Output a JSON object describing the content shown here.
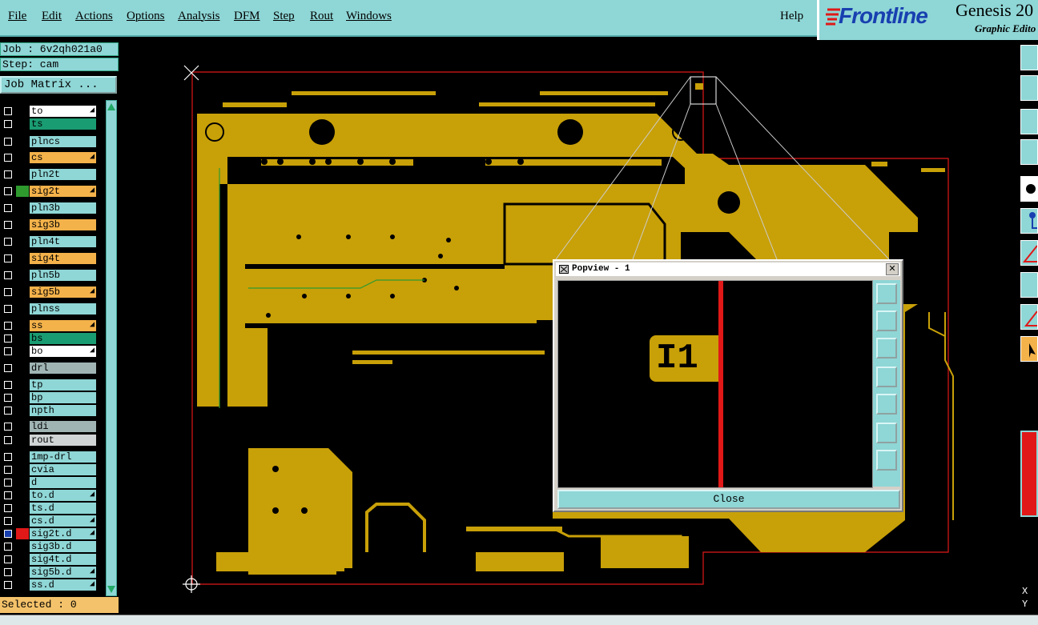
{
  "menu": [
    "File",
    "Edit",
    "Actions",
    "Options",
    "Analysis",
    "DFM",
    "Step",
    "Rout",
    "Windows"
  ],
  "help": "Help",
  "brand": {
    "logo": "Frontline",
    "product": "Genesis 20",
    "subtitle": "Graphic Edito"
  },
  "job": {
    "job_label": "Job : 6v2qh021a0",
    "step_label": "Step: cam",
    "matrix_button": "Job Matrix ..."
  },
  "layers": [
    {
      "name": "to",
      "color": "#ffffff",
      "arrow": true
    },
    {
      "name": "ts",
      "color": "#1a9c72",
      "arrow": false
    },
    {
      "name": "plncs",
      "color": "#8fd6d6",
      "arrow": false
    },
    {
      "name": "cs",
      "color": "#f4b24a",
      "arrow": true
    },
    {
      "name": "pln2t",
      "color": "#8fd6d6",
      "arrow": false
    },
    {
      "name": "sig2t",
      "color": "#f4b24a",
      "arrow": true,
      "swatch": "#2e9a2e"
    },
    {
      "name": "pln3b",
      "color": "#8fd6d6",
      "arrow": false
    },
    {
      "name": "sig3b",
      "color": "#f4b24a",
      "arrow": false
    },
    {
      "name": "pln4t",
      "color": "#8fd6d6",
      "arrow": false
    },
    {
      "name": "sig4t",
      "color": "#f4b24a",
      "arrow": false
    },
    {
      "name": "pln5b",
      "color": "#8fd6d6",
      "arrow": false
    },
    {
      "name": "sig5b",
      "color": "#f4b24a",
      "arrow": true
    },
    {
      "name": "plnss",
      "color": "#8fd6d6",
      "arrow": false
    },
    {
      "name": "ss",
      "color": "#f4b24a",
      "arrow": true
    },
    {
      "name": "bs",
      "color": "#1a9c72",
      "arrow": false
    },
    {
      "name": "bo",
      "color": "#ffffff",
      "arrow": true
    },
    {
      "name": "drl",
      "color": "#a0b4b4",
      "arrow": false
    },
    {
      "name": "tp",
      "color": "#8fd6d6",
      "arrow": false
    },
    {
      "name": "bp",
      "color": "#8fd6d6",
      "arrow": false
    },
    {
      "name": "npth",
      "color": "#8fd6d6",
      "arrow": false
    },
    {
      "name": "ldi",
      "color": "#a0b4b4",
      "arrow": false
    },
    {
      "name": "rout",
      "color": "#d0d4d4",
      "arrow": false
    },
    {
      "name": "1mp-drl",
      "color": "#8fd6d6",
      "arrow": false
    },
    {
      "name": "cvia",
      "color": "#8fd6d6",
      "arrow": false
    },
    {
      "name": "d",
      "color": "#8fd6d6",
      "arrow": false
    },
    {
      "name": "to.d",
      "color": "#8fd6d6",
      "arrow": true
    },
    {
      "name": "ts.d",
      "color": "#8fd6d6",
      "arrow": false
    },
    {
      "name": "cs.d",
      "color": "#8fd6d6",
      "arrow": true
    },
    {
      "name": "sig2t.d",
      "color": "#8fd6d6",
      "arrow": true,
      "swatch": "#e01818",
      "checked": true
    },
    {
      "name": "sig3b.d",
      "color": "#8fd6d6",
      "arrow": false
    },
    {
      "name": "sig4t.d",
      "color": "#8fd6d6",
      "arrow": false
    },
    {
      "name": "sig5b.d",
      "color": "#8fd6d6",
      "arrow": true
    },
    {
      "name": "ss.d",
      "color": "#8fd6d6",
      "arrow": true
    }
  ],
  "selected": "Selected : 0",
  "popview": {
    "title": "Popview - 1",
    "close_label": "Close",
    "component_label": "I1"
  },
  "coords": {
    "x": "X",
    "y": "Y"
  },
  "colors": {
    "copper": "#c8a008",
    "panel": "#8fd6d6",
    "outline": "#e01818"
  }
}
